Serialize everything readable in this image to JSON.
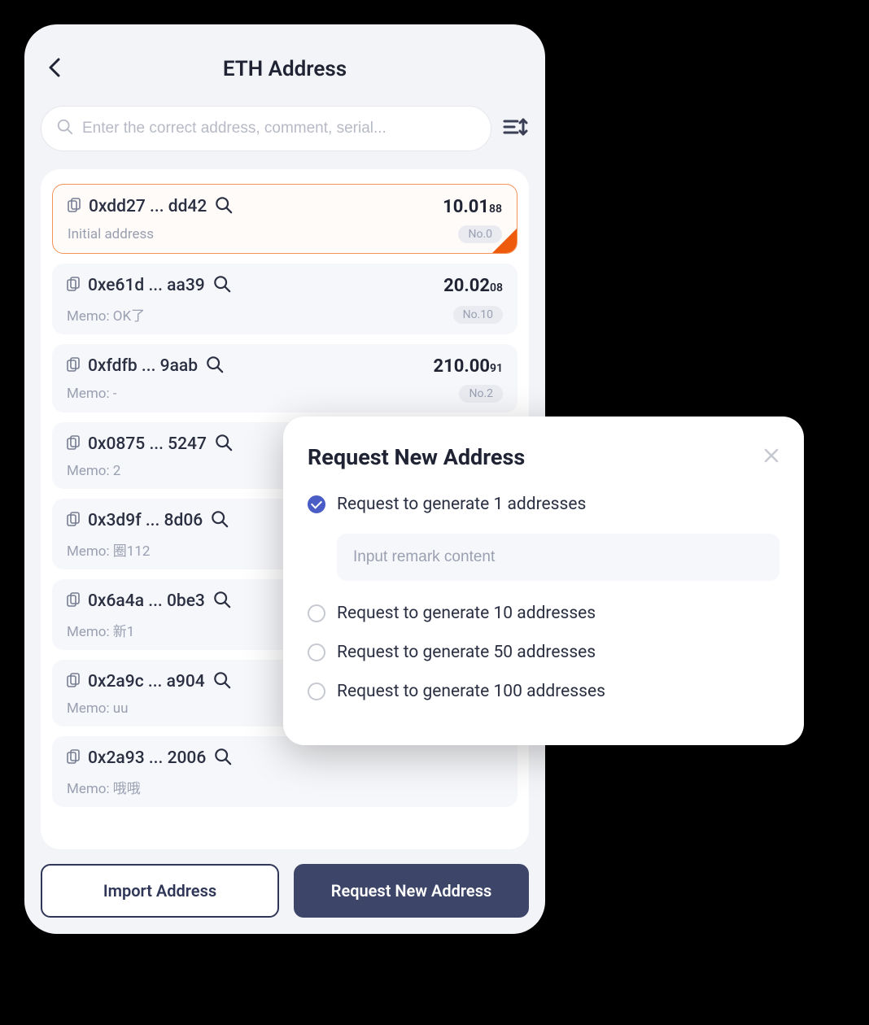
{
  "header": {
    "title": "ETH Address"
  },
  "search": {
    "placeholder": "Enter the correct address, comment, serial..."
  },
  "addresses": [
    {
      "addr": "0xdd27 ... dd42",
      "balance_int": "10.01",
      "balance_dec": "88",
      "memo": "Initial address",
      "no": "No.0",
      "selected": true
    },
    {
      "addr": "0xe61d ... aa39",
      "balance_int": "20.02",
      "balance_dec": "08",
      "memo": "Memo: OK了",
      "no": "No.10",
      "selected": false
    },
    {
      "addr": "0xfdfb ... 9aab",
      "balance_int": "210.00",
      "balance_dec": "91",
      "memo": "Memo: -",
      "no": "No.2",
      "selected": false
    },
    {
      "addr": "0x0875 ... 5247",
      "balance_int": "",
      "balance_dec": "",
      "memo": "Memo: 2",
      "no": "",
      "selected": false
    },
    {
      "addr": "0x3d9f ... 8d06",
      "balance_int": "",
      "balance_dec": "",
      "memo": "Memo: 圈112",
      "no": "",
      "selected": false
    },
    {
      "addr": "0x6a4a ... 0be3",
      "balance_int": "",
      "balance_dec": "",
      "memo": "Memo: 新1",
      "no": "",
      "selected": false
    },
    {
      "addr": "0x2a9c ... a904",
      "balance_int": "",
      "balance_dec": "",
      "memo": "Memo: uu",
      "no": "",
      "selected": false
    },
    {
      "addr": "0x2a93 ... 2006",
      "balance_int": "",
      "balance_dec": "",
      "memo": "Memo: 哦哦",
      "no": "",
      "selected": false
    }
  ],
  "buttons": {
    "import": "Import Address",
    "request": "Request New Address"
  },
  "modal": {
    "title": "Request New Address",
    "remark_placeholder": "Input remark content",
    "options": [
      {
        "label": "Request to generate 1 addresses",
        "checked": true
      },
      {
        "label": "Request to generate 10 addresses",
        "checked": false
      },
      {
        "label": "Request to generate 50 addresses",
        "checked": false
      },
      {
        "label": "Request to generate 100 addresses",
        "checked": false
      }
    ]
  }
}
